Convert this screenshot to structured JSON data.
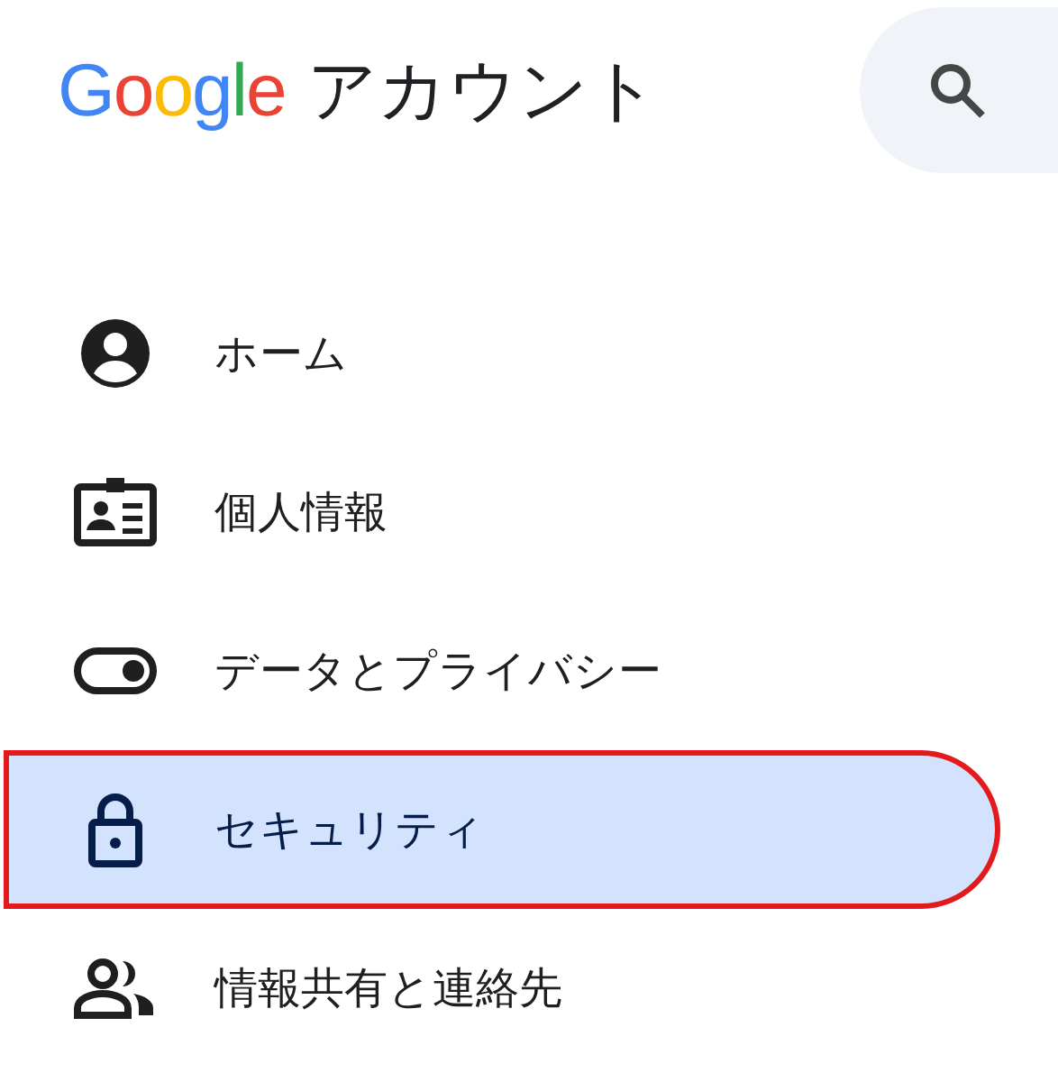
{
  "header": {
    "logo": "Google",
    "title": "アカウント"
  },
  "nav": [
    {
      "label": "ホーム",
      "selected": false,
      "highlighted": false
    },
    {
      "label": "個人情報",
      "selected": false,
      "highlighted": false
    },
    {
      "label": "データとプライバシー",
      "selected": false,
      "highlighted": false
    },
    {
      "label": "セキュリティ",
      "selected": true,
      "highlighted": true
    },
    {
      "label": "情報共有と連絡先",
      "selected": false,
      "highlighted": false
    }
  ]
}
